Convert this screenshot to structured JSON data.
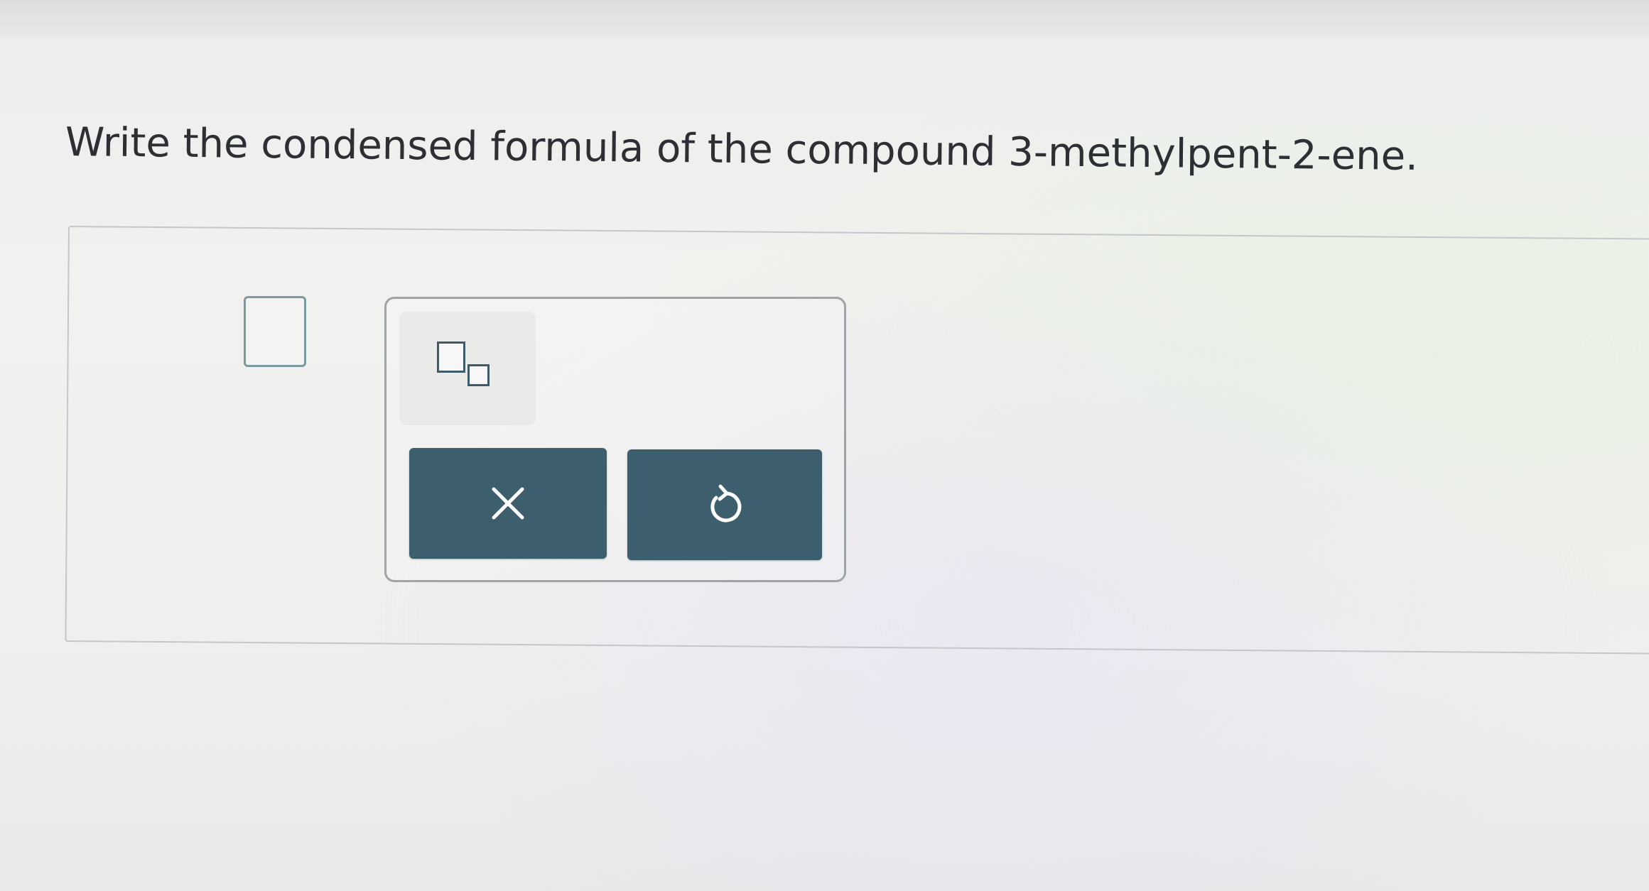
{
  "question": {
    "text": "Write the condensed formula of the compound 3-methylpent-2-ene."
  },
  "answer": {
    "value": ""
  },
  "toolbox": {
    "subscript_icon": "subscript-box-icon",
    "clear_icon": "x-icon",
    "undo_icon": "undo-icon"
  },
  "colors": {
    "button_bg": "#3d5e6c",
    "icon_stroke": "#ffffff",
    "tool_outline": "#3f5a68",
    "answer_box_border": "#7a9aa3"
  }
}
